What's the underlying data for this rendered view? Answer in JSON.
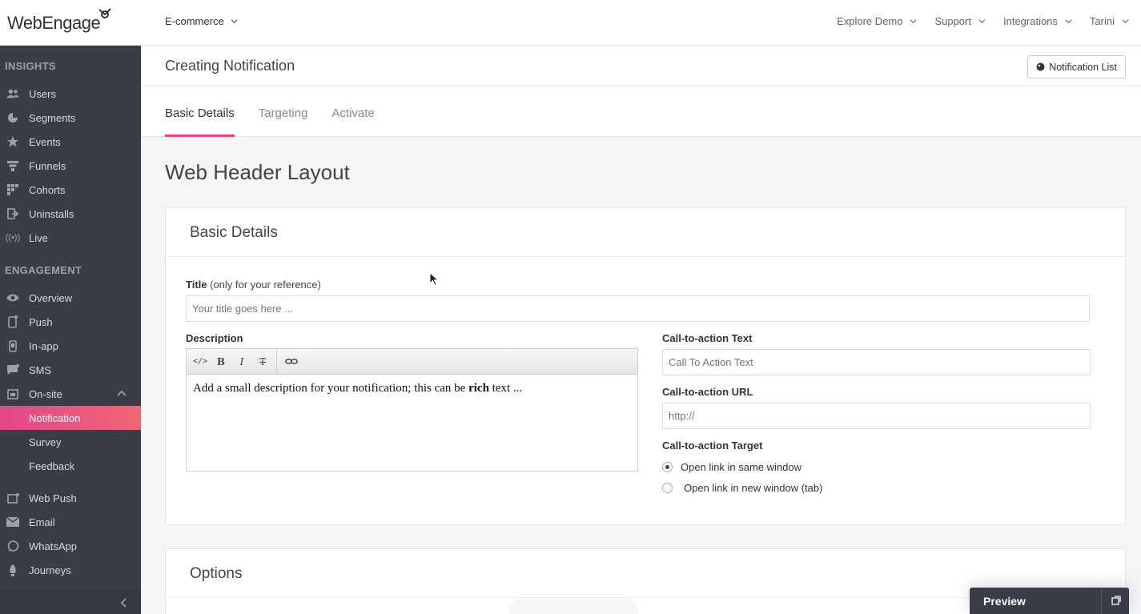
{
  "brand": {
    "logo_text": "WebEngage",
    "accent": "#e8457d",
    "sidebar_bg": "#3a3d48"
  },
  "header": {
    "project": "E-commerce",
    "nav": [
      "Explore Demo",
      "Support",
      "Integrations",
      "Tarini"
    ]
  },
  "sidebar": {
    "insights_title": "INSIGHTS",
    "insights": [
      {
        "label": "Users",
        "icon": "users-icon"
      },
      {
        "label": "Segments",
        "icon": "pie-chart-icon"
      },
      {
        "label": "Events",
        "icon": "star-icon"
      },
      {
        "label": "Funnels",
        "icon": "funnel-icon"
      },
      {
        "label": "Cohorts",
        "icon": "grid-icon"
      },
      {
        "label": "Uninstalls",
        "icon": "exit-icon"
      },
      {
        "label": "Live",
        "icon": "broadcast-icon"
      }
    ],
    "engagement_title": "ENGAGEMENT",
    "engagement": [
      {
        "label": "Overview",
        "icon": "eye-icon"
      },
      {
        "label": "Push",
        "icon": "mobile-push-icon"
      },
      {
        "label": "In-app",
        "icon": "mobile-icon"
      },
      {
        "label": "SMS",
        "icon": "chat-icon"
      },
      {
        "label": "On-site",
        "icon": "browser-icon"
      }
    ],
    "onsite_sub": [
      "Notification",
      "Survey",
      "Feedback"
    ],
    "channels": [
      {
        "label": "Web Push",
        "icon": "web-push-icon"
      },
      {
        "label": "Email",
        "icon": "envelope-icon"
      },
      {
        "label": "WhatsApp",
        "icon": "whatsapp-icon"
      },
      {
        "label": "Journeys",
        "icon": "rocket-icon"
      }
    ]
  },
  "page": {
    "title": "Creating Notification",
    "notification_list_button": "Notification List",
    "tabs": [
      "Basic Details",
      "Targeting",
      "Activate"
    ],
    "layout_title": "Web Header Layout"
  },
  "basic_details": {
    "heading": "Basic Details",
    "title_label": "Title",
    "title_note": "(only for your reference)",
    "title_placeholder": "Your title goes here ...",
    "description_label": "Description",
    "description_text_before": "Add a small description for your notification; this can be ",
    "description_text_bold": "rich",
    "description_text_after": " text ...",
    "cta_text_label": "Call-to-action Text",
    "cta_text_placeholder": "Call To Action Text",
    "cta_url_label": "Call-to-action URL",
    "cta_url_placeholder": "http://",
    "cta_target_label": "Call-to-action Target",
    "cta_target_options": [
      "Open link in same window",
      "Open link in new window (tab)"
    ],
    "cta_target_selected": "Open link in same window"
  },
  "options": {
    "heading": "Options"
  },
  "preview": {
    "label": "Preview"
  }
}
